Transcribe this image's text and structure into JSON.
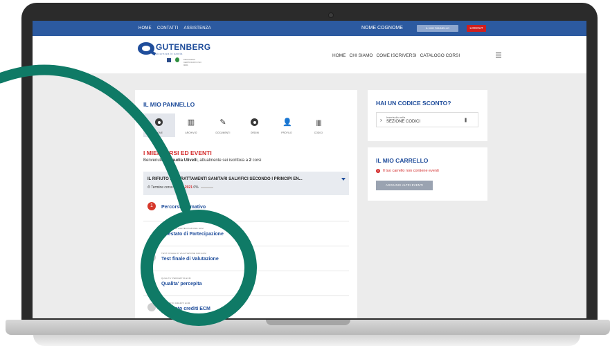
{
  "topbar": {
    "links": [
      "HOME",
      "CONTATTI",
      "ASSISTENZA"
    ],
    "user_name": "NOME COGNOME",
    "panel_button": "IL MIO PANNELLO",
    "logout_button": "LOGOUT"
  },
  "header": {
    "logo_name": "GUTENBERG",
    "logo_tagline": "sicurezza in sanità",
    "cert_text": "PROCESSO CERTIFICATO ISO 9001",
    "nav": [
      "HOME",
      "CHI SIAMO",
      "COME ISCRIVERSI",
      "CATALOGO CORSI"
    ]
  },
  "panel": {
    "title": "IL MIO PANNELLO",
    "tabs": [
      {
        "label": "HOME",
        "icon": "home-circle-icon"
      },
      {
        "label": "ARCHIVIO",
        "icon": "archive-icon"
      },
      {
        "label": "DOCUMENTI",
        "icon": "documents-icon"
      },
      {
        "label": "ORDINI",
        "icon": "orders-icon"
      },
      {
        "label": "PROFILO",
        "icon": "profile-icon"
      },
      {
        "label": "CODICI",
        "icon": "barcode-icon"
      }
    ],
    "courses_title": "I MIEI CORSI ED EVENTI",
    "welcome_prefix": "Benvenuto/a",
    "welcome_name": "Claudia Ulivelli",
    "welcome_mid": ", attualmente sei iscritto/a a",
    "welcome_count": "2",
    "welcome_suffix": "corsi",
    "course": {
      "title": "IL RIFIUTO DEI TRATTAMENTI SANITARI SALVIFICI SECONDO I PRINCIPI EN...",
      "deadline_label": "Termine corso:",
      "deadline_date": "19-03-2021",
      "progress": "0%"
    },
    "steps": [
      {
        "number": "1",
        "small": "",
        "label": "Percorso formativo"
      },
      {
        "number": "",
        "small": "ATTESTATO DI PARTECIPAZIONE ECM",
        "label": "Attestato di Partecipazione"
      },
      {
        "number": "",
        "small": "TEST FINALE DI VALUTAZIONE FAD ECM",
        "label": "Test finale di Valutazione"
      },
      {
        "number": "",
        "small": "QUALITA' PERCEPITA ECM",
        "label": "Qualita' percepita"
      },
      {
        "number": "",
        "small": "ATTESTATO CREDITI ECM",
        "label": "Attestato crediti ECM"
      }
    ]
  },
  "discount": {
    "title": "HAI UN CODICE SCONTO?",
    "hint": "Inseriscilo nella",
    "link": "SEZIONE CODICI"
  },
  "cart": {
    "title": "IL MIO CARRELLO",
    "alert_icon": "!",
    "empty_message": "Il tuo carrello non contiene eventi",
    "add_button": "AGGIUNGI ALTRI EVENTI"
  },
  "colors": {
    "brand_blue": "#1f4d9b",
    "topbar_blue": "#2c5aa0",
    "alert_red": "#d32b2b",
    "decoration_teal": "#0f7a66"
  }
}
